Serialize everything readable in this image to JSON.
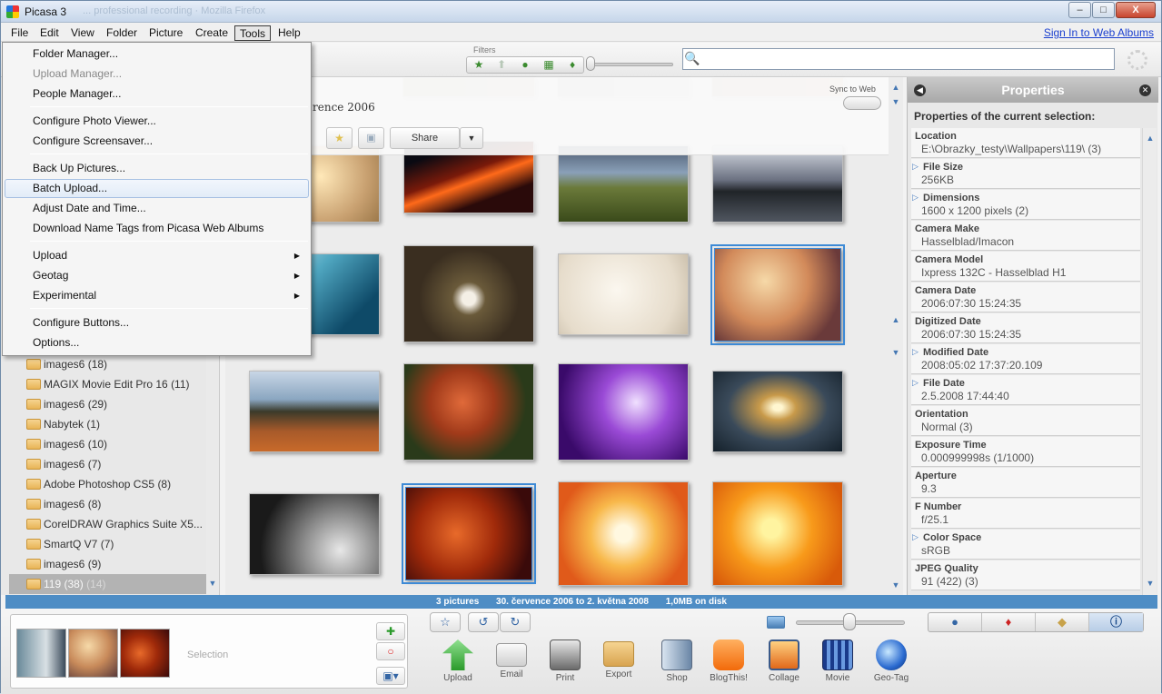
{
  "window": {
    "title": "Picasa 3",
    "ghost_title": "... professional recording · Mozilla Firefox",
    "minimize": "–",
    "maximize": "□",
    "close": "X"
  },
  "menu": {
    "items": [
      "File",
      "Edit",
      "View",
      "Folder",
      "Picture",
      "Create",
      "Tools",
      "Help"
    ],
    "open": "Tools",
    "signin": "Sign In to Web Albums"
  },
  "toolbar": {
    "filters_label": "Filters",
    "search_placeholder": ""
  },
  "tools_menu": [
    {
      "label": "Folder Manager...",
      "disabled": false
    },
    {
      "label": "Upload Manager...",
      "disabled": true
    },
    {
      "label": "People Manager...",
      "disabled": false
    },
    {
      "label": "Configure Photo Viewer...",
      "disabled": false
    },
    {
      "label": "Configure Screensaver...",
      "disabled": false
    },
    {
      "label": "Back Up Pictures...",
      "disabled": false
    },
    {
      "label": "Batch Upload...",
      "disabled": false,
      "highlighted": true
    },
    {
      "label": "Adjust Date and Time...",
      "disabled": false
    },
    {
      "label": "Download Name Tags from Picasa Web Albums",
      "disabled": false
    },
    {
      "label": "Upload",
      "submenu": true
    },
    {
      "label": "Geotag",
      "submenu": true
    },
    {
      "label": "Experimental",
      "submenu": true
    },
    {
      "label": "Configure Buttons...",
      "disabled": false
    },
    {
      "label": "Options...",
      "disabled": false
    }
  ],
  "folders": [
    {
      "name": "images6",
      "count": "(18)"
    },
    {
      "name": "MAGIX Movie Edit Pro 16",
      "count": "(11)"
    },
    {
      "name": "images6",
      "count": "(29)"
    },
    {
      "name": "Nabytek",
      "count": "(1)"
    },
    {
      "name": "images6",
      "count": "(10)"
    },
    {
      "name": "images6",
      "count": "(7)"
    },
    {
      "name": "Adobe Photoshop CS5",
      "count": "(8)"
    },
    {
      "name": "images6",
      "count": "(8)"
    },
    {
      "name": "CorelDRAW Graphics Suite X5...",
      "count": ""
    },
    {
      "name": "SmartQ V7",
      "count": "(7)"
    },
    {
      "name": "images6",
      "count": "(9)"
    },
    {
      "name": "119 (38)",
      "count": "(14)",
      "selected": true
    }
  ],
  "album": {
    "title_fragment": "rence 2006",
    "sync_label": "Sync to Web",
    "share": "Share",
    "share_arrow": "▼"
  },
  "properties": {
    "title": "Properties",
    "subtitle": "Properties of the current selection:",
    "rows": [
      {
        "label": "Location",
        "value": "E:\\Obrazky_testy\\Wallpapers\\119\\ (3)",
        "expandable": false
      },
      {
        "label": "File Size",
        "value": "256KB",
        "expandable": true
      },
      {
        "label": "Dimensions",
        "value": "1600 x 1200 pixels (2)",
        "expandable": true
      },
      {
        "label": "Camera Make",
        "value": "Hasselblad/Imacon",
        "expandable": false
      },
      {
        "label": "Camera Model",
        "value": "Ixpress 132C - Hasselblad H1",
        "expandable": false
      },
      {
        "label": "Camera Date",
        "value": "2006:07:30 15:24:35",
        "expandable": false
      },
      {
        "label": "Digitized Date",
        "value": "2006:07:30 15:24:35",
        "expandable": false
      },
      {
        "label": "Modified Date",
        "value": "2008:05:02 17:37:20.109",
        "expandable": true
      },
      {
        "label": "File Date",
        "value": "2.5.2008 17:44:40",
        "expandable": true
      },
      {
        "label": "Orientation",
        "value": "Normal (3)",
        "expandable": false
      },
      {
        "label": "Exposure Time",
        "value": "0.000999998s (1/1000)",
        "expandable": false
      },
      {
        "label": "Aperture",
        "value": "9.3",
        "expandable": false
      },
      {
        "label": "F Number",
        "value": "f/25.1",
        "expandable": false
      },
      {
        "label": "Color Space",
        "value": "sRGB",
        "expandable": true
      },
      {
        "label": "JPEG Quality",
        "value": "91 (422) (3)",
        "expandable": false
      }
    ]
  },
  "status": {
    "pictures": "3 pictures",
    "dates": "30. července 2006 to 2. května 2008",
    "size": "1,0MB on disk"
  },
  "tray": {
    "selection_label": "Selection"
  },
  "actions": [
    {
      "label": "Upload",
      "icon": "upload-icon"
    },
    {
      "label": "Email",
      "icon": "email-icon"
    },
    {
      "label": "Print",
      "icon": "print-icon"
    },
    {
      "label": "Export",
      "icon": "export-icon"
    },
    {
      "label": "Shop",
      "icon": "shop-icon"
    },
    {
      "label": "BlogThis!",
      "icon": "blogthis-icon"
    },
    {
      "label": "Collage",
      "icon": "collage-icon"
    },
    {
      "label": "Movie",
      "icon": "movie-icon"
    },
    {
      "label": "Geo-Tag",
      "icon": "geotag-icon"
    }
  ],
  "colors": {
    "accent": "#4e8dc5",
    "selection": "#3d8ad6",
    "menu_highlight": "#a6c0e2"
  }
}
